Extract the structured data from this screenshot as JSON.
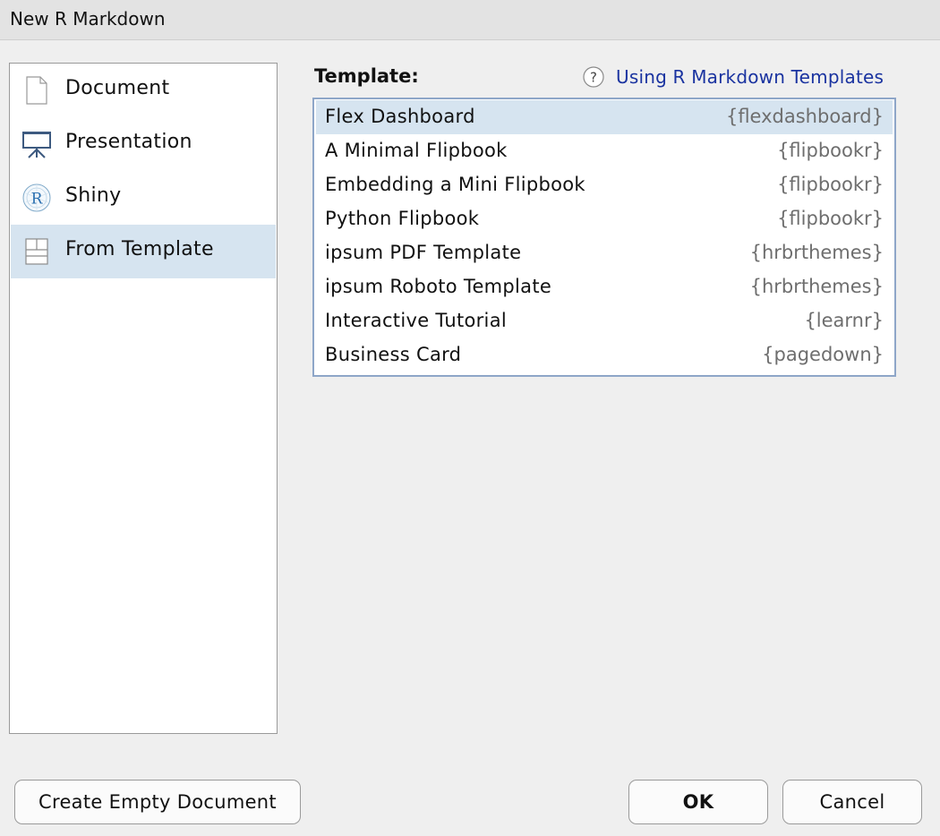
{
  "window": {
    "title": "New R Markdown"
  },
  "sidebar": {
    "items": [
      {
        "label": "Document",
        "icon": "document-icon",
        "selected": false
      },
      {
        "label": "Presentation",
        "icon": "presentation-icon",
        "selected": false
      },
      {
        "label": "Shiny",
        "icon": "shiny-icon",
        "selected": false
      },
      {
        "label": "From Template",
        "icon": "template-icon",
        "selected": true
      }
    ]
  },
  "template_panel": {
    "heading": "Template:",
    "help_icon": "help-icon",
    "help_link": "Using R Markdown Templates",
    "rows": [
      {
        "name": "Flex Dashboard",
        "package": "{flexdashboard}",
        "selected": true
      },
      {
        "name": "A Minimal Flipbook",
        "package": "{flipbookr}",
        "selected": false
      },
      {
        "name": "Embedding a Mini Flipbook",
        "package": "{flipbookr}",
        "selected": false
      },
      {
        "name": "Python Flipbook",
        "package": "{flipbookr}",
        "selected": false
      },
      {
        "name": "ipsum PDF Template",
        "package": "{hrbrthemes}",
        "selected": false
      },
      {
        "name": "ipsum Roboto Template",
        "package": "{hrbrthemes}",
        "selected": false
      },
      {
        "name": "Interactive Tutorial",
        "package": "{learnr}",
        "selected": false
      },
      {
        "name": "Business Card",
        "package": "{pagedown}",
        "selected": false
      }
    ]
  },
  "buttons": {
    "create_empty": "Create Empty Document",
    "ok": "OK",
    "cancel": "Cancel"
  },
  "colors": {
    "selection": "#d6e4f0",
    "link": "#1a33a0",
    "list_border": "#8ea6c8",
    "package_text": "#6e6e6e"
  }
}
